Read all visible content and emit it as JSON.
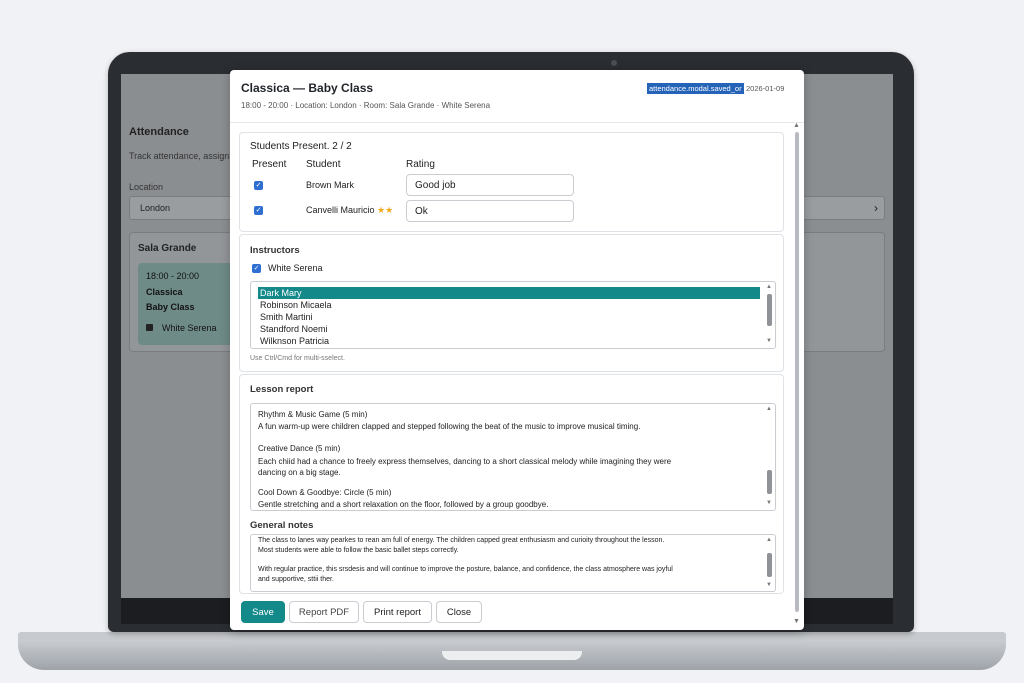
{
  "background": {
    "title": "Attendance",
    "subtitle": "Track attendance, assign",
    "location_label": "Location",
    "location_value": "London",
    "room": {
      "name": "Sala Grande",
      "card": {
        "time": "18:00 - 20:00",
        "title": "Classica",
        "subtitle": "Baby Class",
        "instructor": "White Serena"
      }
    }
  },
  "modal": {
    "title": "Classica — Baby Class",
    "subtitle": "18:00 - 20:00 · Location: London · Room: Sala Grande · White Serena",
    "saved_key": "attendance.modal.saved_or",
    "saved_date": "2026-01-09",
    "students": {
      "count_label": "Students Present. 2 / 2",
      "columns": [
        "Present",
        "Student",
        "Rating"
      ],
      "rows": [
        {
          "name": "Brown Mark",
          "stars": "",
          "rating": "Good job",
          "present": true
        },
        {
          "name": "Canvelli Mauricio",
          "stars": "★★",
          "rating": "Ok",
          "present": true
        }
      ]
    },
    "instructors": {
      "label": "Instructors",
      "selected_instructor": "White Serena",
      "list": [
        "Dark Mary",
        "Robinson Micaela",
        "Smith Martini",
        "Standford Noemi",
        "Wilknson Patricia"
      ],
      "selected_index": 0,
      "hint": "Use Ctrl/Cmd for multi-sselect."
    },
    "lesson_report": {
      "label": "Lesson report",
      "lines": [
        "Rhythm & Music Game (5 min)",
        "A fun warm-up were children clapped and stepped following the beat of the music to improve musical timing.",
        "Creative Dance (5 min)",
        "Each chiid had a chance to freely express themselves, dancing to a short classical melody while imagining they were",
        "dancing on a big stage.",
        "Cool Down & Goodbye: Circle (5 min)",
        "Gentle stretching and a short relaxation on the floor, followed by a group goodbye."
      ]
    },
    "general_notes": {
      "label": "General notes",
      "lines": [
        "The class to lanes way pearkes to rean am full of energy. The children capped great enthusiasm and curioity throughout the lesson.",
        "Most students were able to follow the basic ballet steps correctly.",
        "With regular practice, this srsdesis and will continue to improve the posture, balance, and confidence, the class atmosphere was joyful",
        "and supportive, sttii ther."
      ]
    },
    "buttons": {
      "save": "Save",
      "report_pdf": "Report PDF",
      "print_report": "Print report",
      "close": "Close"
    }
  }
}
